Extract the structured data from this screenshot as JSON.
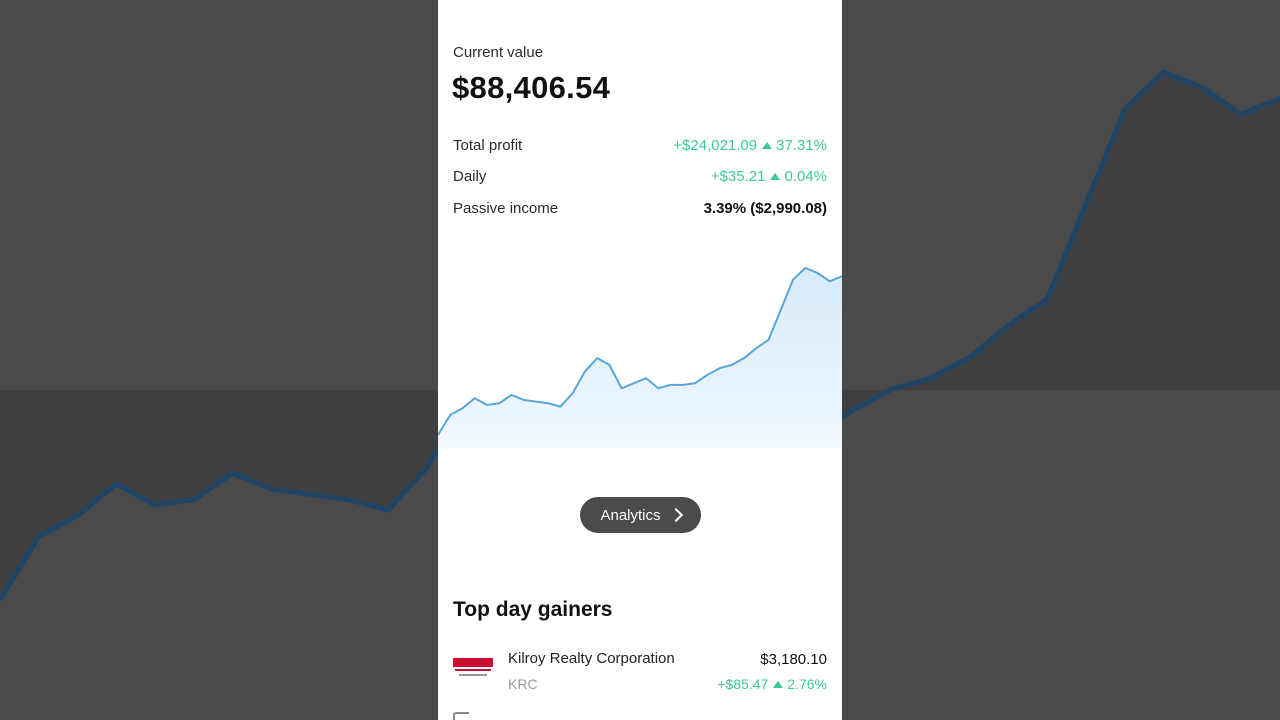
{
  "portfolio": {
    "current_value_label": "Current value",
    "current_value": "$88,406.54",
    "rows": [
      {
        "label": "Total profit",
        "value": "+$24,021.09",
        "percent": "37.31%"
      },
      {
        "label": "Daily",
        "value": "+$35.21",
        "percent": "0.04%"
      },
      {
        "label": "Passive income",
        "value": "3.39% ($2,990.08)"
      }
    ]
  },
  "analytics_button": {
    "label": "Analytics",
    "icon": "chevron-right-icon"
  },
  "top_gainers": {
    "title": "Top day gainers",
    "items": [
      {
        "name": "Kilroy Realty Corporation",
        "ticker": "KRC",
        "value": "$3,180.10",
        "change": "+$85.47",
        "percent": "2.76%",
        "logo": "kilroy-realty-logo"
      }
    ]
  },
  "colors": {
    "positive": "#3cc995",
    "line": "#5aa5d8",
    "fill": "#dcefff",
    "background": "#4a4a4a"
  },
  "chart_data": {
    "type": "area",
    "series": [
      {
        "values": [
          0.0,
          0.12,
          0.16,
          0.22,
          0.18,
          0.19,
          0.24,
          0.21,
          0.2,
          0.19,
          0.17,
          0.25,
          0.38,
          0.46,
          0.42,
          0.28,
          0.31,
          0.34,
          0.28,
          0.3,
          0.3,
          0.31,
          0.36,
          0.4,
          0.42,
          0.46,
          0.52,
          0.57,
          0.75,
          0.93,
          1.0,
          0.97,
          0.92,
          0.95
        ]
      }
    ]
  }
}
